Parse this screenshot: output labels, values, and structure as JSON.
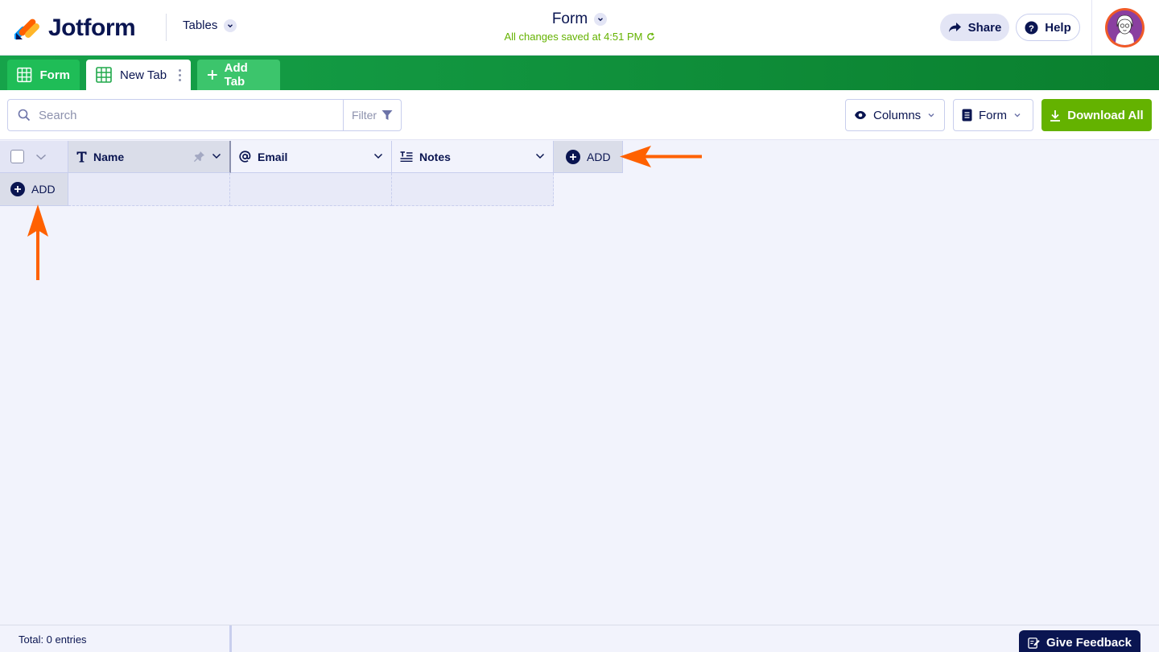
{
  "header": {
    "logo_text": "Jotform",
    "app_switcher_label": "Tables",
    "form_title": "Form",
    "save_status": "All changes saved at 4:51 PM",
    "share_label": "Share",
    "help_label": "Help",
    "avatar_icon": "user-avatar-icon"
  },
  "tabs": [
    {
      "label": "Form",
      "icon": "table-grid-icon",
      "active": false
    },
    {
      "label": "New Tab",
      "icon": "table-grid-icon",
      "active": true
    },
    {
      "label": "Add Tab",
      "icon": "plus-icon"
    }
  ],
  "toolbar": {
    "search_placeholder": "Search",
    "filter_label": "Filter",
    "columns_label": "Columns",
    "view_label": "Form",
    "download_label": "Download All"
  },
  "grid": {
    "columns": [
      {
        "label": "Name",
        "icon": "text-type-icon",
        "pinned": true
      },
      {
        "label": "Email",
        "icon": "at-sign-icon"
      },
      {
        "label": "Notes",
        "icon": "long-text-icon"
      }
    ],
    "add_column_label": "ADD",
    "add_row_label": "ADD"
  },
  "footer": {
    "total_label": "Total: 0 entries",
    "feedback_label": "Give Feedback"
  },
  "colors": {
    "brand_navy": "#0a1551",
    "tab_bar_green": "#0b8a35",
    "download_green": "#64b200",
    "annotation_arrow": "#ff6100"
  }
}
